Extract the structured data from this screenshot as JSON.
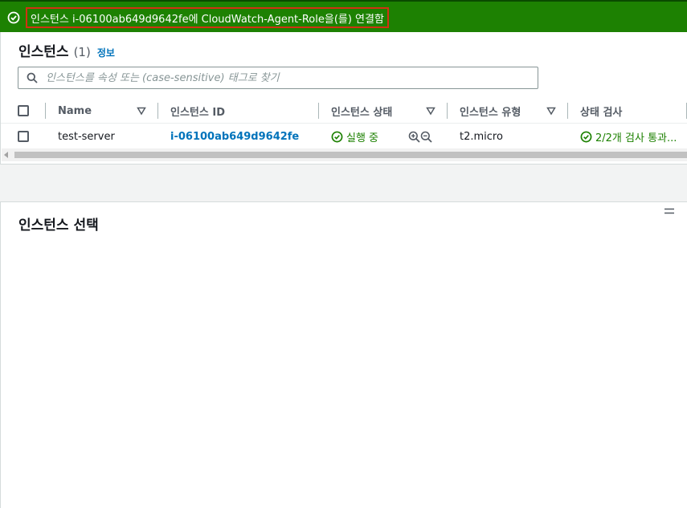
{
  "flash": {
    "message": "인스턴스 i-06100ab649d9642fe에 CloudWatch-Agent-Role을(를) 연결함",
    "icon": "success-check-icon",
    "bg_color": "#1d8102"
  },
  "instances": {
    "title": "인스턴스",
    "count": "(1)",
    "info_link": "정보",
    "search_placeholder": "인스턴스를 속성 또는 (case-sensitive) 태그로 찾기",
    "columns": [
      "Name",
      "인스턴스 ID",
      "인스턴스 상태",
      "인스턴스 유형",
      "상태 검사"
    ],
    "rows": [
      {
        "name": "test-server",
        "instance_id": "i-06100ab649d9642fe",
        "state": "실행 중",
        "type": "t2.micro",
        "status_check": "2/2개 검사 통과..."
      }
    ]
  },
  "details": {
    "title": "인스턴스 선택"
  },
  "colors": {
    "link": "#0073bb",
    "success": "#1d8102"
  }
}
